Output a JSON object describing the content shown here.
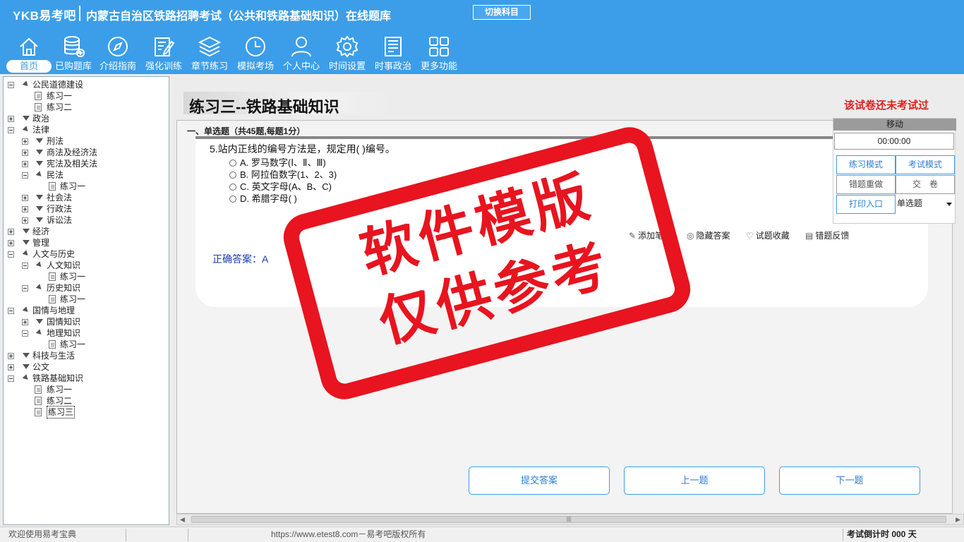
{
  "header": {
    "brand": "YKB易考吧",
    "title": "内蒙古自治区铁路招聘考试（公共和铁路基础知识）在线题库",
    "switch_subject": "切换科目",
    "colors": {
      "header_bg": "#3c9ee8",
      "stamp_red": "#e8141f",
      "answer_blue": "#1a3db0",
      "warning_red": "#e02020"
    }
  },
  "toolbar": [
    {
      "label": "首页",
      "icon": "home-icon"
    },
    {
      "label": "已购题库",
      "icon": "database-icon"
    },
    {
      "label": "介绍指南",
      "icon": "compass-icon"
    },
    {
      "label": "强化训练",
      "icon": "edit-icon"
    },
    {
      "label": "章节练习",
      "icon": "layers-icon"
    },
    {
      "label": "模拟考场",
      "icon": "clock-icon"
    },
    {
      "label": "个人中心",
      "icon": "user-icon"
    },
    {
      "label": "时间设置",
      "icon": "gear-icon"
    },
    {
      "label": "时事政治",
      "icon": "news-icon"
    },
    {
      "label": "更多功能",
      "icon": "grid-icon"
    }
  ],
  "tree": [
    "公民道德建设",
    "练习一",
    "练习二",
    "政治",
    "法律",
    "刑法",
    "商法及经济法",
    "宪法及相关法",
    "民法",
    "练习一",
    "社会法",
    "行政法",
    "诉讼法",
    "经济",
    "管理",
    "人文与历史",
    "人文知识",
    "练习一",
    "历史知识",
    "练习一",
    "国情与地理",
    "国情知识",
    "地理知识",
    "练习一",
    "科技与生活",
    "公文",
    "铁路基础知识",
    "练习一",
    "练习二",
    "练习三"
  ],
  "main": {
    "paper_title": "练习三--铁路基础知识",
    "not_taken": "该试卷还未考试过",
    "section_title": "一、单选题（共45题,每题1分）",
    "question": "5.站内正线的编号方法是，规定用( )编号。",
    "options": [
      "A. 罗马数字(Ⅰ、Ⅱ、Ⅲ)",
      "B. 阿拉伯数字(1、2、3)",
      "C. 英文字母(A、B、C)",
      "D. 希腊字母( )"
    ],
    "tools": [
      "添加笔记",
      "隐藏答案",
      "试题收藏",
      "错题反馈"
    ],
    "answer_label": "正确答案：",
    "answer": "A",
    "buttons": {
      "submit": "提交答案",
      "prev": "上一题",
      "next": "下一题"
    }
  },
  "float_panel": {
    "move": "移动",
    "timer": "00:00:00",
    "practice_mode": "练习模式",
    "exam_mode": "考试模式",
    "redo_wrong": "错题重做",
    "hand_in": "交　卷",
    "print": "打印入口",
    "qtype": "单选题"
  },
  "stamp": {
    "line1": "软件模版",
    "line2": "仅供参考"
  },
  "status": {
    "left": "欢迎使用易考宝典",
    "mid": "https://www.etest8.com－易考吧版权所有",
    "right": "考试倒计时 000 天"
  }
}
